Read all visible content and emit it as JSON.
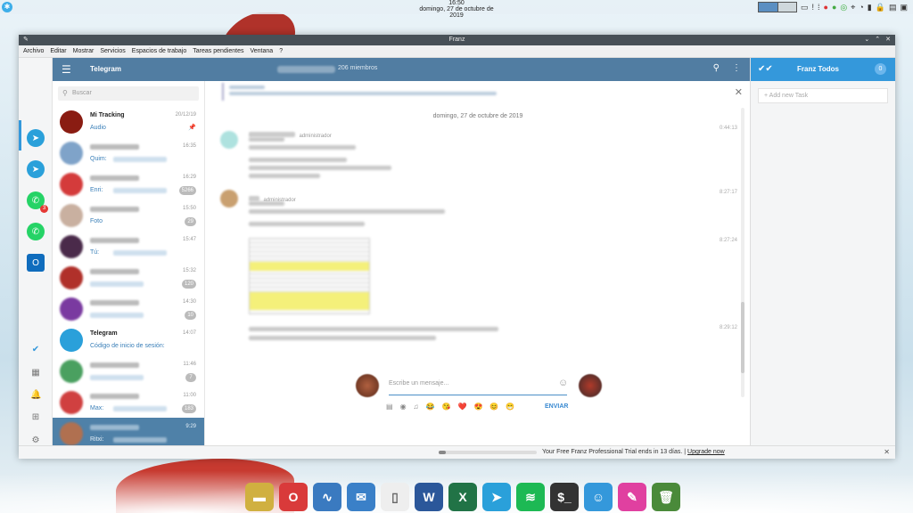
{
  "desktop": {
    "clock_time": "16:50",
    "clock_date": "domingo, 27 de octubre de 2019"
  },
  "window": {
    "title": "Franz",
    "menu": [
      "Archivo",
      "Editar",
      "Mostrar",
      "Servicios",
      "Espacios de trabajo",
      "Tareas pendientes",
      "Ventana",
      "?"
    ]
  },
  "services": [
    {
      "icon": "messenger-icon",
      "badge": "2"
    },
    {
      "icon": "messenger-icon",
      "badge": ""
    },
    {
      "icon": "telegram-icon",
      "badge": ""
    },
    {
      "icon": "telegram-icon",
      "badge": ""
    },
    {
      "icon": "whatsapp-icon",
      "badge": "3"
    },
    {
      "icon": "whatsapp-icon",
      "badge": ""
    },
    {
      "icon": "outlook-icon",
      "badge": ""
    }
  ],
  "telegram": {
    "title": "Telegram",
    "members": "206 miembros",
    "search_placeholder": "Buscar",
    "chats": [
      {
        "name": "Mi Tracking",
        "preview": "Audio",
        "time": "20/12/19",
        "count": "",
        "avatar_color": "#8a1c12",
        "blurred_name": false,
        "blurred_preview": false
      },
      {
        "name": "",
        "preview": "Quim:",
        "time": "16:35",
        "count": "",
        "avatar_color": "#7fa3c9",
        "blurred_name": true,
        "blurred_preview": true
      },
      {
        "name": "",
        "preview": "Enri:",
        "time": "16:29",
        "count": "5266",
        "avatar_color": "#d43b3b",
        "blurred_name": true,
        "blurred_preview": true
      },
      {
        "name": "",
        "preview": "Foto",
        "time": "15:50",
        "count": "29",
        "avatar_color": "#c9b0a0",
        "blurred_name": true,
        "blurred_preview": false
      },
      {
        "name": "",
        "preview": "Tú:",
        "time": "15:47",
        "count": "",
        "avatar_color": "#4a2a4a",
        "blurred_name": true,
        "blurred_preview": true
      },
      {
        "name": "",
        "preview": "",
        "time": "15:32",
        "count": "120",
        "avatar_color": "#b0302a",
        "blurred_name": true,
        "blurred_preview": true
      },
      {
        "name": "",
        "preview": "",
        "time": "14:30",
        "count": "10",
        "avatar_color": "#7a3aa0",
        "blurred_name": true,
        "blurred_preview": true
      },
      {
        "name": "Telegram",
        "preview": "Código de inicio de sesión:",
        "time": "14:07",
        "count": "",
        "avatar_color": "#2aa0da",
        "blurred_name": false,
        "blurred_preview": false
      },
      {
        "name": "",
        "preview": "",
        "time": "11:46",
        "count": "7",
        "avatar_color": "#4aa060",
        "blurred_name": true,
        "blurred_preview": true
      },
      {
        "name": "",
        "preview": "Max:",
        "time": "11:00",
        "count": "183",
        "avatar_color": "#d04040",
        "blurred_name": true,
        "blurred_preview": true
      },
      {
        "name": "",
        "preview": "Ritxi:",
        "time": "9:29",
        "count": "",
        "avatar_color": "#b07050",
        "blurred_name": true,
        "blurred_preview": true,
        "active": true
      }
    ],
    "date_separator": "domingo, 27 de octubre de 2019",
    "messages": [
      {
        "role": "administrador",
        "time": "0:44:13"
      },
      {
        "role": "administrador",
        "time": "8:27:17"
      },
      {
        "role": "",
        "time": "8:27:24"
      },
      {
        "role": "",
        "time": "8:29:12"
      }
    ],
    "composer_placeholder": "Escribe un mensaje...",
    "send_label": "ENVIAR",
    "quick_emojis": [
      "😂",
      "😘",
      "❤️",
      "😍",
      "😊",
      "😁"
    ]
  },
  "todos": {
    "title": "Franz Todos",
    "count": "0",
    "placeholder": "+ Add new Task"
  },
  "trial": {
    "text": "Your Free Franz Professional Trial ends in 13 días.",
    "link": "Upgrade now",
    "progress": 0.07
  },
  "dock": [
    {
      "icon": "files-icon",
      "color": "#d0b040",
      "glyph": "▬"
    },
    {
      "icon": "opera-icon",
      "color": "#d93a3a",
      "glyph": "O"
    },
    {
      "icon": "monitor-icon",
      "color": "#3a7ac0",
      "glyph": "∿"
    },
    {
      "icon": "thunderbird-icon",
      "color": "#3a80c8",
      "glyph": "✉"
    },
    {
      "icon": "document-icon",
      "color": "#eeeeee",
      "glyph": "▯"
    },
    {
      "icon": "word-icon",
      "color": "#2b579a",
      "glyph": "W"
    },
    {
      "icon": "excel-icon",
      "color": "#217346",
      "glyph": "X"
    },
    {
      "icon": "telegram-icon",
      "color": "#2aa0da",
      "glyph": "➤"
    },
    {
      "icon": "spotify-icon",
      "color": "#1db954",
      "glyph": "≋"
    },
    {
      "icon": "terminal-icon",
      "color": "#333333",
      "glyph": "$_"
    },
    {
      "icon": "franz-icon",
      "color": "#3498db",
      "glyph": "☺"
    },
    {
      "icon": "color-picker-icon",
      "color": "#e040a0",
      "glyph": "✎"
    },
    {
      "icon": "trash-icon",
      "color": "#4a8a3a",
      "glyph": "🗑"
    }
  ]
}
